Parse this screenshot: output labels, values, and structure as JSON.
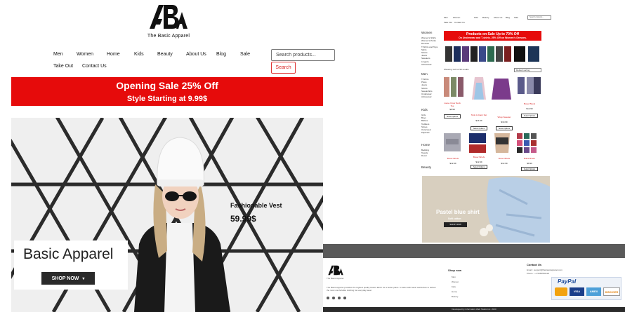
{
  "store": {
    "logo_text": "The Basic Apparel",
    "nav": [
      "Men",
      "Women",
      "Home",
      "Kids",
      "Beauty",
      "About Us",
      "Blog",
      "Sale",
      "Take Out",
      "Contact Us"
    ],
    "search": {
      "placeholder": "Search products...",
      "button": "Search"
    },
    "sale_banner": {
      "line1": "Opening Sale 25% Off",
      "line2": "Style Starting at 9.99$"
    },
    "hero": {
      "title": "Basic Apparel",
      "cta": "SHOP NOW",
      "product_label": "Fashionable Vest",
      "product_price": "59.99$"
    }
  },
  "preview": {
    "nav": [
      "Men",
      "Women",
      "Kids",
      "Beauty",
      "About Us",
      "Blog",
      "Sale",
      "Take Out",
      "Contact Us"
    ],
    "search_placeholder": "Search products...",
    "banner": {
      "line1": "Products on Sale Up to 70% Off",
      "line2": "On Underwear and T-shirts. 25% Off on Women's Dresses."
    },
    "results": "Showing 1-24 of 50 results",
    "sort": "Default sorting",
    "sidebar": {
      "women": "Women",
      "women_items": [
        "Women's Shirts",
        "Women's Pants",
        "Dresses",
        "T-Shirts and Tops",
        "Skirts",
        "Shorts",
        "Jeans",
        "Sweaters",
        "Lingerie",
        "Activewear"
      ],
      "men": "Men",
      "men_items": [
        "T-Shirts",
        "Polos",
        "Jeans",
        "Shorts",
        "Sweatshirts",
        "Underwear",
        "Activewear"
      ],
      "kids": "Kids",
      "kids_items": [
        "Girls",
        "Boys",
        "Babies",
        "Toddlers",
        "Shoes",
        "Outerwear",
        "Pajamas"
      ],
      "home": "Home",
      "home_items": [
        "Bedding",
        "Towels",
        "Decor"
      ],
      "beauty": "Beauty"
    },
    "products": [
      {
        "name": "Loose Crew Neck Tee",
        "price": "$9.99",
        "button": "Select Options"
      },
      {
        "name": "Tank & Cami Set",
        "price": "$14.99",
        "button": "Select Options"
      },
      {
        "name": "Wrap Sweater",
        "price": "$19.99",
        "button": "Select Options"
      },
      {
        "name": "Boxer Briefs",
        "price": "$12.99",
        "button": "Select Options"
      },
      {
        "name": "Boxer Briefs",
        "price": "$12.99",
        "button": "Select Options"
      },
      {
        "name": "Boxer Briefs",
        "price": "$12.99",
        "button": "Select Options"
      },
      {
        "name": "Boxer Briefs",
        "price": "$12.99",
        "button": "Select Options"
      },
      {
        "name": "Bikini Briefs",
        "price": "$9.99",
        "button": "Select Options"
      }
    ],
    "promo": {
      "title": "Pastel blue shirt",
      "subtitle": "Soft cotton",
      "button": "SHOP NOW"
    },
    "footer": {
      "logo_text": "The Basic Apparel",
      "about": "The Basic Apparel provides the highest quality basics fabric for a better place. It starts with basic wardrobes to deliver the most comfortable clothing for everyday wear.",
      "shop_heading": "Shop now",
      "shop_links": [
        "Men",
        "Women",
        "Kids",
        "Home",
        "Beauty"
      ],
      "contact_heading": "Contact Us",
      "email": "Email : support@thebasicapparel.com",
      "phone": "Phone : +1 5555550123",
      "paypal": "PayPal",
      "cards": [
        "VISA",
        "AMEX",
        "DISCOVER"
      ],
      "copyright": "Developed by Informatics Web Studio Inc. 2020"
    }
  },
  "colors": {
    "sale_red": "#e60b0b",
    "dark_button": "#2a2a2a",
    "accent_red": "#d71f1f"
  }
}
